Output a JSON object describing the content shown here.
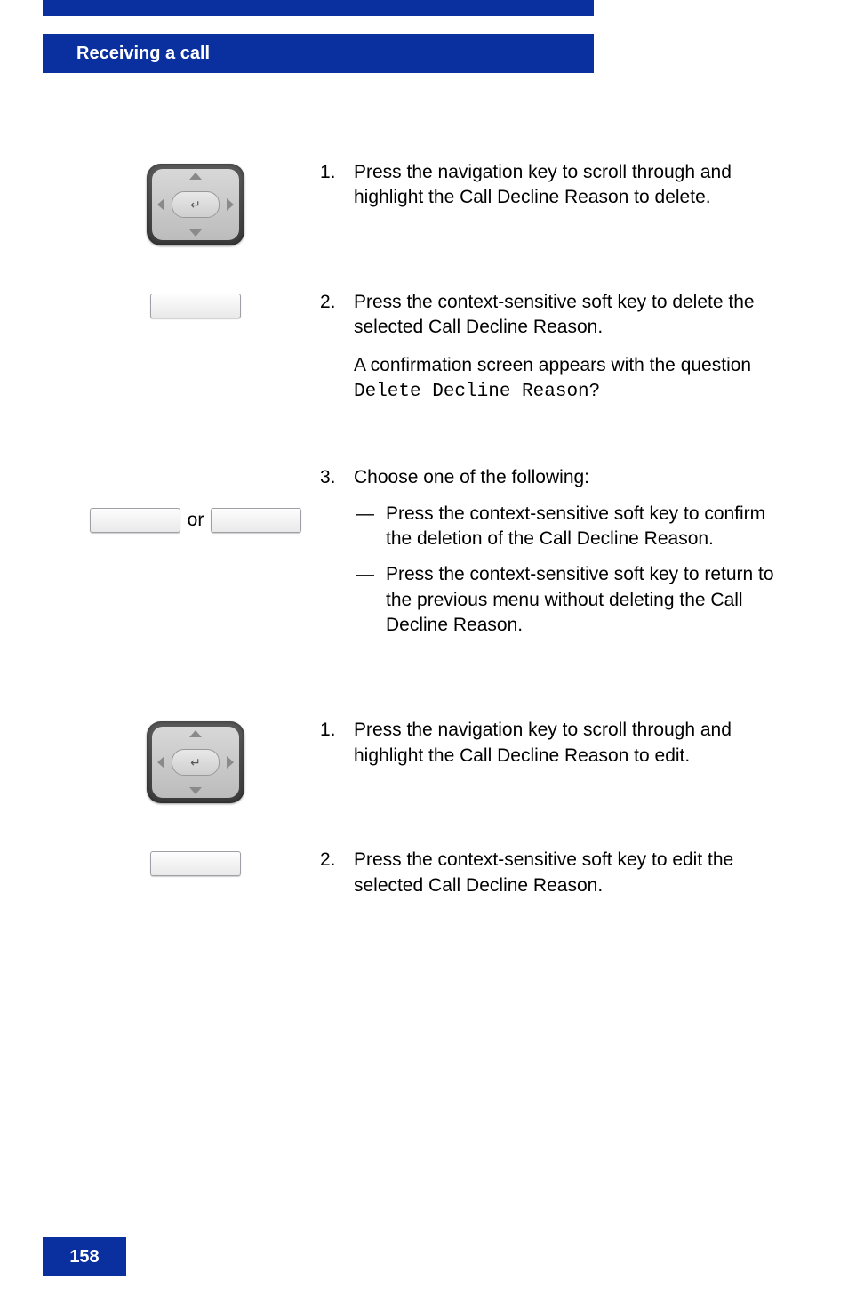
{
  "header": {
    "title": "Receiving a call"
  },
  "footer": {
    "page_number": "158"
  },
  "block1": {
    "step1": {
      "num": "1.",
      "pre": "Press the ",
      "post": " navigation key to scroll through and highlight the Call Decline Reason to delete."
    },
    "step2": {
      "num": "2.",
      "p1_pre": "Press the ",
      "p1_post": " context-sensitive soft key to delete the selected Call Decline Reason.",
      "p2_pre": "A confirmation screen appears with the question ",
      "p2_code": "Delete Decline Reason?"
    },
    "step3": {
      "num": "3.",
      "intro": "Choose one of the following:",
      "dash": "—",
      "a_pre": "Press the ",
      "a_post": " context-sensitive soft key to confirm the deletion of the Call Decline Reason.",
      "b_pre": "Press the ",
      "b_post": " context-sensitive soft key to return to the previous menu without deleting the Call Decline Reason."
    },
    "or": "or"
  },
  "block2": {
    "step1": {
      "num": "1.",
      "pre": "Press the ",
      "post": " navigation key to scroll through and highlight the Call Decline Reason to edit."
    },
    "step2": {
      "num": "2.",
      "pre": "Press the ",
      "post": " context-sensitive soft key to edit the selected Call Decline Reason."
    }
  }
}
